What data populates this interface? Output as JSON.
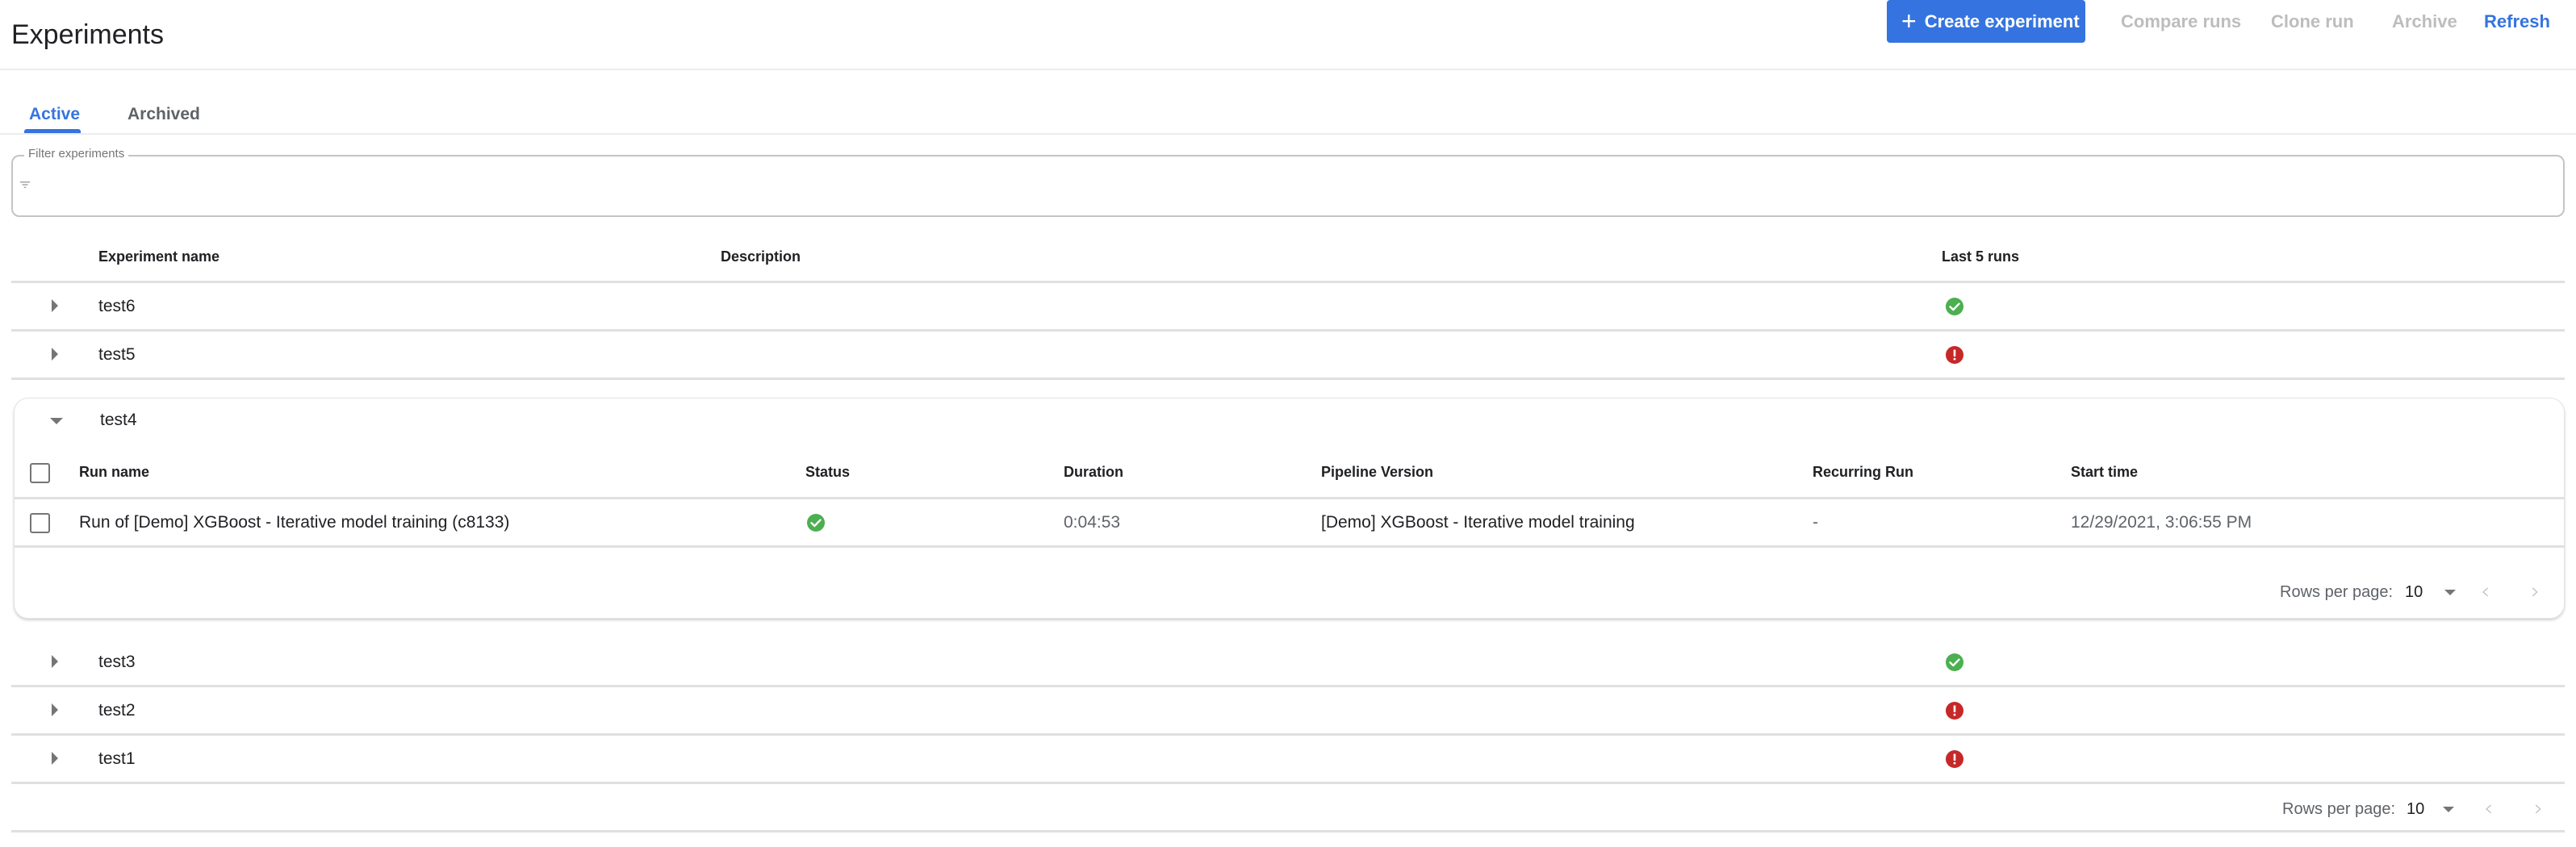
{
  "header": {
    "title": "Experiments",
    "buttons": {
      "create": "Create experiment",
      "compare": "Compare runs",
      "clone": "Clone run",
      "archive": "Archive",
      "refresh": "Refresh"
    }
  },
  "tabs": [
    {
      "label": "Active",
      "selected": true
    },
    {
      "label": "Archived",
      "selected": false
    }
  ],
  "filter": {
    "label": "Filter experiments",
    "value": "",
    "icon": "filter-icon"
  },
  "table": {
    "columns": [
      "Experiment name",
      "Description",
      "Last 5 runs"
    ],
    "rows_before": [
      {
        "name": "test6",
        "description": "",
        "last_runs": [
          "success"
        ]
      },
      {
        "name": "test5",
        "description": "",
        "last_runs": [
          "error"
        ]
      }
    ],
    "expanded": {
      "name": "test4",
      "run_columns": [
        "Run name",
        "Status",
        "Duration",
        "Pipeline Version",
        "Recurring Run",
        "Start time"
      ],
      "runs": [
        {
          "name": "Run of [Demo] XGBoost - Iterative model training (c8133)",
          "status": "success",
          "duration": "0:04:53",
          "pipeline_version": "[Demo] XGBoost - Iterative model training",
          "recurring_run": "-",
          "start_time": "12/29/2021, 3:06:55 PM"
        }
      ],
      "pagination": {
        "label": "Rows per page:",
        "value": "10"
      }
    },
    "rows_after": [
      {
        "name": "test3",
        "description": "",
        "last_runs": [
          "success"
        ]
      },
      {
        "name": "test2",
        "description": "",
        "last_runs": [
          "error"
        ]
      },
      {
        "name": "test1",
        "description": "",
        "last_runs": [
          "error"
        ]
      }
    ],
    "pagination": {
      "label": "Rows per page:",
      "value": "10"
    }
  },
  "colors": {
    "accent": "#3574e0",
    "success": "#4caf50",
    "error": "#c62828",
    "disabled": "#bdbdbd"
  }
}
